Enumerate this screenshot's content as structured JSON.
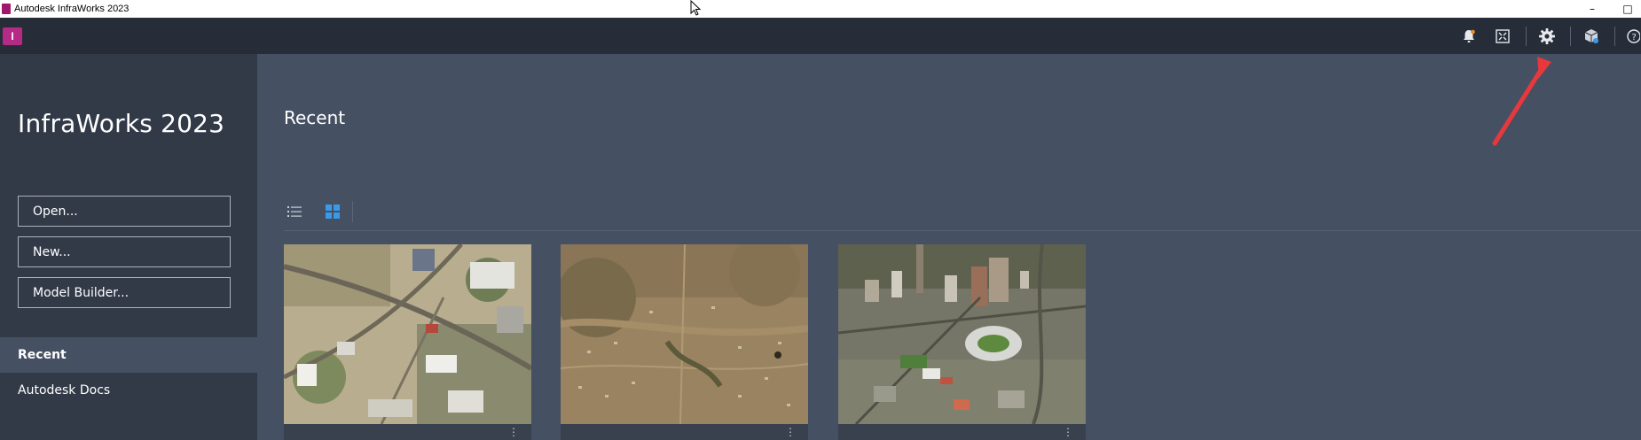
{
  "window": {
    "title": "Autodesk InfraWorks 2023",
    "minimize_glyph": "–",
    "restore_glyph": "□"
  },
  "toolbar": {
    "logo_letter": "I",
    "icons": [
      "notification-bell-icon",
      "fit-screen-icon",
      "settings-gear-icon",
      "autodesk-cube-icon",
      "help-icon"
    ]
  },
  "sidebar": {
    "product_title": "InfraWorks 2023",
    "buttons": [
      {
        "label": "Open..."
      },
      {
        "label": "New..."
      },
      {
        "label": "Model Builder..."
      }
    ],
    "nav": [
      {
        "label": "Recent",
        "active": true
      },
      {
        "label": "Autodesk Docs",
        "active": false
      }
    ]
  },
  "main": {
    "section_title": "Recent",
    "view_modes": [
      "list-view-icon",
      "grid-view-icon"
    ],
    "active_view": "grid",
    "cards": [
      {
        "thumbnail": "aerial-town-roads"
      },
      {
        "thumbnail": "aerial-desert-terrain"
      },
      {
        "thumbnail": "aerial-city-stadium"
      }
    ]
  },
  "colors": {
    "toolbar_bg": "#272d38",
    "sidebar_bg": "#323a48",
    "main_bg": "#465063",
    "accent_blue": "#3a9ae8",
    "annotation_red": "#e8383d",
    "logo_magenta": "#b52a86"
  }
}
